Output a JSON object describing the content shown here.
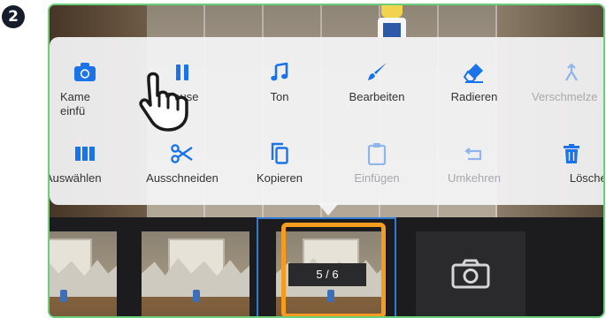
{
  "step": "2",
  "menu": {
    "row1": [
      {
        "id": "camera",
        "label": "Kamera einfügen",
        "label_line1": "Kame",
        "label_line2": "einfü",
        "disabled": false
      },
      {
        "id": "pause",
        "label": "Pause",
        "disabled": false
      },
      {
        "id": "sound",
        "label": "Ton",
        "disabled": false
      },
      {
        "id": "edit",
        "label": "Bearbeiten",
        "disabled": false
      },
      {
        "id": "erase",
        "label": "Radieren",
        "disabled": false
      },
      {
        "id": "merge",
        "label": "Verschmelzen",
        "display": "Verschmelze",
        "disabled": true
      }
    ],
    "row2": [
      {
        "id": "select",
        "label": "Auswählen",
        "disabled": false
      },
      {
        "id": "cut",
        "label": "Ausschneiden",
        "disabled": false
      },
      {
        "id": "copy",
        "label": "Kopieren",
        "disabled": false
      },
      {
        "id": "paste",
        "label": "Einfügen",
        "disabled": true
      },
      {
        "id": "reverse",
        "label": "Umkehren",
        "disabled": true
      },
      {
        "id": "delete",
        "label": "Löschen",
        "disabled": false
      }
    ]
  },
  "filmstrip": {
    "counter": "5 / 6"
  },
  "colors": {
    "accent": "#1a73e8",
    "disabled": "#a8a8ad",
    "highlight": "#f39c1f",
    "frame_border": "#6bcf7a"
  }
}
